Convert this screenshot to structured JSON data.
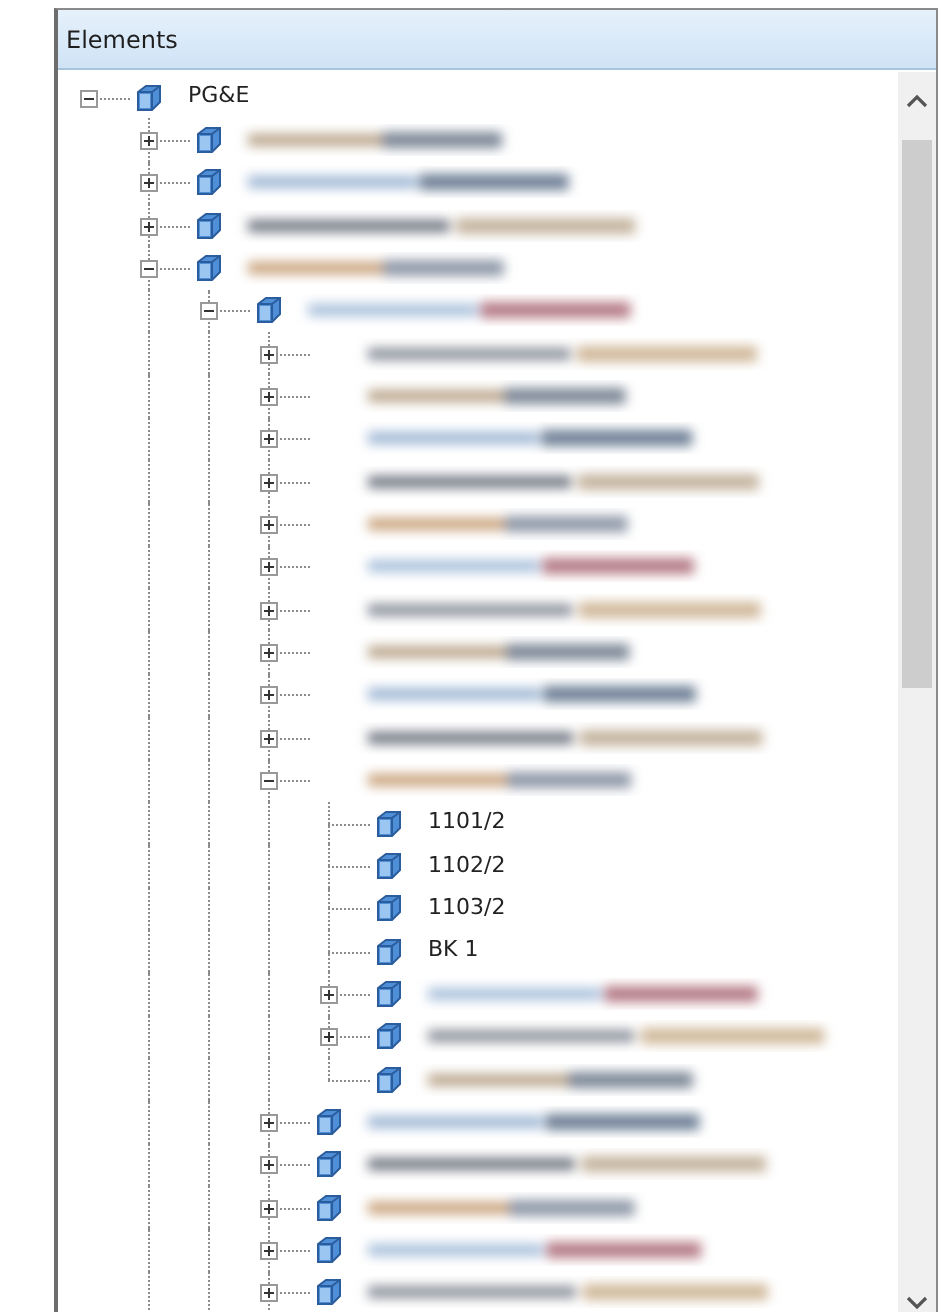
{
  "panel": {
    "title": "Elements"
  },
  "tree": [
    {
      "label": "PG&E",
      "expanded": true,
      "children": [
        {
          "redacted": true,
          "expanded": false
        },
        {
          "redacted": true,
          "expanded": false
        },
        {
          "redacted": true,
          "expanded": false
        },
        {
          "redacted": true,
          "expanded": true,
          "continues": true,
          "children": [
            {
              "redacted": true,
              "expanded": true,
              "continues": true,
              "children": [
                {
                  "redacted": true,
                  "icon_hidden": true,
                  "expanded": false
                },
                {
                  "redacted": true,
                  "icon_hidden": true,
                  "expanded": false
                },
                {
                  "redacted": true,
                  "icon_hidden": true,
                  "expanded": false
                },
                {
                  "redacted": true,
                  "icon_hidden": true,
                  "expanded": false
                },
                {
                  "redacted": true,
                  "icon_hidden": true,
                  "expanded": false
                },
                {
                  "redacted": true,
                  "icon_hidden": true,
                  "expanded": false
                },
                {
                  "redacted": true,
                  "icon_hidden": true,
                  "expanded": false
                },
                {
                  "redacted": true,
                  "icon_hidden": true,
                  "expanded": false
                },
                {
                  "redacted": true,
                  "icon_hidden": true,
                  "expanded": false
                },
                {
                  "redacted": true,
                  "icon_hidden": true,
                  "expanded": false
                },
                {
                  "redacted": true,
                  "icon_hidden": true,
                  "expanded": true,
                  "children": [
                    {
                      "label": "1101/2"
                    },
                    {
                      "label": "1102/2"
                    },
                    {
                      "label": "1103/2"
                    },
                    {
                      "label": "BK 1"
                    },
                    {
                      "redacted": true,
                      "expanded": false
                    },
                    {
                      "redacted": true,
                      "expanded": false
                    },
                    {
                      "redacted": true
                    }
                  ]
                },
                {
                  "redacted": true,
                  "expanded": false
                },
                {
                  "redacted": true,
                  "expanded": false
                },
                {
                  "redacted": true,
                  "expanded": false
                },
                {
                  "redacted": true,
                  "expanded": false
                },
                {
                  "redacted": true,
                  "expanded": false,
                  "continues": true
                }
              ]
            }
          ]
        }
      ]
    }
  ]
}
